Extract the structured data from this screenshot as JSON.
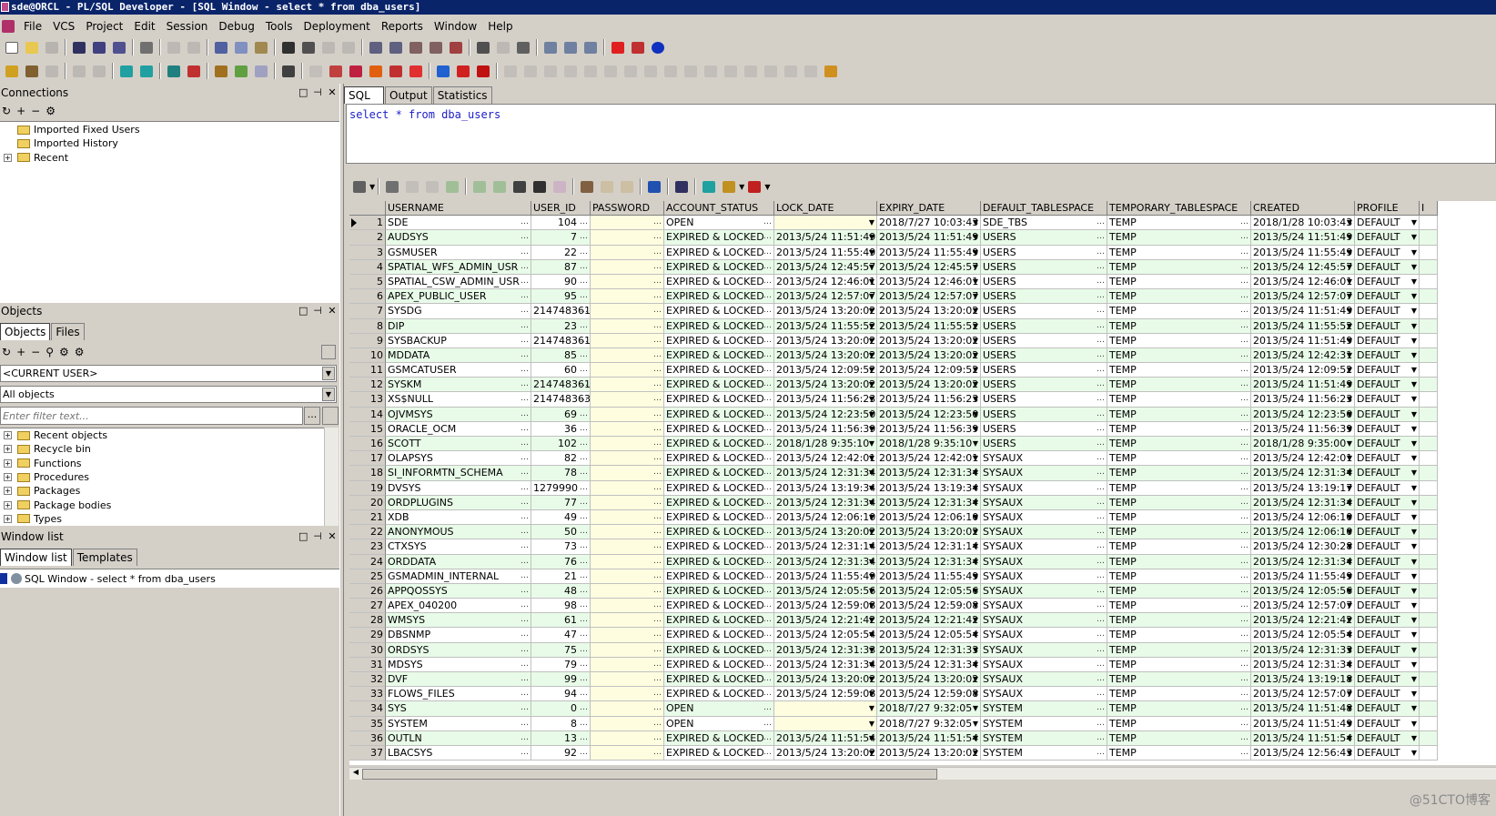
{
  "window_title": "sde@ORCL - PL/SQL Developer - [SQL Window - select * from dba_users]",
  "menu": [
    "File",
    "VCS",
    "Project",
    "Edit",
    "Session",
    "Debug",
    "Tools",
    "Deployment",
    "Reports",
    "Window",
    "Help"
  ],
  "connections": {
    "title": "Connections",
    "items": [
      {
        "label": "Imported Fixed Users",
        "expandable": false
      },
      {
        "label": "Imported History",
        "expandable": false
      },
      {
        "label": "Recent",
        "expandable": true
      }
    ]
  },
  "objects": {
    "title": "Objects",
    "tabs": [
      "Objects",
      "Files"
    ],
    "user_combo": "<CURRENT USER>",
    "filter_combo": "All objects",
    "filter_placeholder": "Enter filter text...",
    "filter_button": "...",
    "items": [
      "Recent objects",
      "Recycle bin",
      "Functions",
      "Procedures",
      "Packages",
      "Package bodies",
      "Types"
    ]
  },
  "window_list": {
    "title": "Window list",
    "tabs": [
      "Window list",
      "Templates"
    ],
    "items": [
      "SQL Window - select * from dba_users"
    ]
  },
  "sql_tabs": [
    "SQL",
    "Output",
    "Statistics"
  ],
  "sql_text": "select * from dba_users",
  "grid": {
    "columns": [
      "USERNAME",
      "USER_ID",
      "PASSWORD",
      "ACCOUNT_STATUS",
      "LOCK_DATE",
      "EXPIRY_DATE",
      "DEFAULT_TABLESPACE",
      "TEMPORARY_TABLESPACE",
      "CREATED",
      "PROFILE",
      "I"
    ],
    "rows": [
      [
        "1",
        "SDE",
        "104",
        "",
        "OPEN",
        "",
        "2018/7/27 10:03:43",
        "SDE_TBS",
        "TEMP",
        "2018/1/28 10:03:43",
        "DEFAULT"
      ],
      [
        "2",
        "AUDSYS",
        "7",
        "",
        "EXPIRED & LOCKED",
        "2013/5/24 11:51:49",
        "2013/5/24 11:51:49",
        "USERS",
        "TEMP",
        "2013/5/24 11:51:49",
        "DEFAULT"
      ],
      [
        "3",
        "GSMUSER",
        "22",
        "",
        "EXPIRED & LOCKED",
        "2013/5/24 11:55:49",
        "2013/5/24 11:55:49",
        "USERS",
        "TEMP",
        "2013/5/24 11:55:49",
        "DEFAULT"
      ],
      [
        "4",
        "SPATIAL_WFS_ADMIN_USR",
        "87",
        "",
        "EXPIRED & LOCKED",
        "2013/5/24 12:45:57",
        "2013/5/24 12:45:57",
        "USERS",
        "TEMP",
        "2013/5/24 12:45:57",
        "DEFAULT"
      ],
      [
        "5",
        "SPATIAL_CSW_ADMIN_USR",
        "90",
        "",
        "EXPIRED & LOCKED",
        "2013/5/24 12:46:01",
        "2013/5/24 12:46:01",
        "USERS",
        "TEMP",
        "2013/5/24 12:46:01",
        "DEFAULT"
      ],
      [
        "6",
        "APEX_PUBLIC_USER",
        "95",
        "",
        "EXPIRED & LOCKED",
        "2013/5/24 12:57:07",
        "2013/5/24 12:57:07",
        "USERS",
        "TEMP",
        "2013/5/24 12:57:07",
        "DEFAULT"
      ],
      [
        "7",
        "SYSDG",
        "2147483618",
        "",
        "EXPIRED & LOCKED",
        "2013/5/24 13:20:02",
        "2013/5/24 13:20:02",
        "USERS",
        "TEMP",
        "2013/5/24 11:51:49",
        "DEFAULT"
      ],
      [
        "8",
        "DIP",
        "23",
        "",
        "EXPIRED & LOCKED",
        "2013/5/24 11:55:52",
        "2013/5/24 11:55:52",
        "USERS",
        "TEMP",
        "2013/5/24 11:55:52",
        "DEFAULT"
      ],
      [
        "9",
        "SYSBACKUP",
        "2147483617",
        "",
        "EXPIRED & LOCKED",
        "2013/5/24 13:20:02",
        "2013/5/24 13:20:02",
        "USERS",
        "TEMP",
        "2013/5/24 11:51:49",
        "DEFAULT"
      ],
      [
        "10",
        "MDDATA",
        "85",
        "",
        "EXPIRED & LOCKED",
        "2013/5/24 13:20:02",
        "2013/5/24 13:20:02",
        "USERS",
        "TEMP",
        "2013/5/24 12:42:31",
        "DEFAULT"
      ],
      [
        "11",
        "GSMCATUSER",
        "60",
        "",
        "EXPIRED & LOCKED",
        "2013/5/24 12:09:52",
        "2013/5/24 12:09:52",
        "USERS",
        "TEMP",
        "2013/5/24 12:09:52",
        "DEFAULT"
      ],
      [
        "12",
        "SYSKM",
        "2147483619",
        "",
        "EXPIRED & LOCKED",
        "2013/5/24 13:20:02",
        "2013/5/24 13:20:02",
        "USERS",
        "TEMP",
        "2013/5/24 11:51:49",
        "DEFAULT"
      ],
      [
        "13",
        "XS$NULL",
        "2147483638",
        "",
        "EXPIRED & LOCKED",
        "2013/5/24 11:56:23",
        "2013/5/24 11:56:23",
        "USERS",
        "TEMP",
        "2013/5/24 11:56:23",
        "DEFAULT"
      ],
      [
        "14",
        "OJVMSYS",
        "69",
        "",
        "EXPIRED & LOCKED",
        "2013/5/24 12:23:50",
        "2013/5/24 12:23:50",
        "USERS",
        "TEMP",
        "2013/5/24 12:23:50",
        "DEFAULT"
      ],
      [
        "15",
        "ORACLE_OCM",
        "36",
        "",
        "EXPIRED & LOCKED",
        "2013/5/24 11:56:39",
        "2013/5/24 11:56:39",
        "USERS",
        "TEMP",
        "2013/5/24 11:56:39",
        "DEFAULT"
      ],
      [
        "16",
        "SCOTT",
        "102",
        "",
        "EXPIRED & LOCKED",
        "2018/1/28 9:35:10",
        "2018/1/28 9:35:10",
        "USERS",
        "TEMP",
        "2018/1/28 9:35:00",
        "DEFAULT"
      ],
      [
        "17",
        "OLAPSYS",
        "82",
        "",
        "EXPIRED & LOCKED",
        "2013/5/24 12:42:01",
        "2013/5/24 12:42:01",
        "SYSAUX",
        "TEMP",
        "2013/5/24 12:42:01",
        "DEFAULT"
      ],
      [
        "18",
        "SI_INFORMTN_SCHEMA",
        "78",
        "",
        "EXPIRED & LOCKED",
        "2013/5/24 12:31:34",
        "2013/5/24 12:31:34",
        "SYSAUX",
        "TEMP",
        "2013/5/24 12:31:34",
        "DEFAULT"
      ],
      [
        "19",
        "DVSYS",
        "1279990",
        "",
        "EXPIRED & LOCKED",
        "2013/5/24 13:19:34",
        "2013/5/24 13:19:34",
        "SYSAUX",
        "TEMP",
        "2013/5/24 13:19:17",
        "DEFAULT"
      ],
      [
        "20",
        "ORDPLUGINS",
        "77",
        "",
        "EXPIRED & LOCKED",
        "2013/5/24 12:31:34",
        "2013/5/24 12:31:34",
        "SYSAUX",
        "TEMP",
        "2013/5/24 12:31:34",
        "DEFAULT"
      ],
      [
        "21",
        "XDB",
        "49",
        "",
        "EXPIRED & LOCKED",
        "2013/5/24 12:06:10",
        "2013/5/24 12:06:10",
        "SYSAUX",
        "TEMP",
        "2013/5/24 12:06:10",
        "DEFAULT"
      ],
      [
        "22",
        "ANONYMOUS",
        "50",
        "",
        "EXPIRED & LOCKED",
        "2013/5/24 13:20:02",
        "2013/5/24 13:20:02",
        "SYSAUX",
        "TEMP",
        "2013/5/24 12:06:10",
        "DEFAULT"
      ],
      [
        "23",
        "CTXSYS",
        "73",
        "",
        "EXPIRED & LOCKED",
        "2013/5/24 12:31:14",
        "2013/5/24 12:31:14",
        "SYSAUX",
        "TEMP",
        "2013/5/24 12:30:28",
        "DEFAULT"
      ],
      [
        "24",
        "ORDDATA",
        "76",
        "",
        "EXPIRED & LOCKED",
        "2013/5/24 12:31:34",
        "2013/5/24 12:31:34",
        "SYSAUX",
        "TEMP",
        "2013/5/24 12:31:34",
        "DEFAULT"
      ],
      [
        "25",
        "GSMADMIN_INTERNAL",
        "21",
        "",
        "EXPIRED & LOCKED",
        "2013/5/24 11:55:49",
        "2013/5/24 11:55:49",
        "SYSAUX",
        "TEMP",
        "2013/5/24 11:55:49",
        "DEFAULT"
      ],
      [
        "26",
        "APPQOSSYS",
        "48",
        "",
        "EXPIRED & LOCKED",
        "2013/5/24 12:05:56",
        "2013/5/24 12:05:56",
        "SYSAUX",
        "TEMP",
        "2013/5/24 12:05:56",
        "DEFAULT"
      ],
      [
        "27",
        "APEX_040200",
        "98",
        "",
        "EXPIRED & LOCKED",
        "2013/5/24 12:59:08",
        "2013/5/24 12:59:08",
        "SYSAUX",
        "TEMP",
        "2013/5/24 12:57:07",
        "DEFAULT"
      ],
      [
        "28",
        "WMSYS",
        "61",
        "",
        "EXPIRED & LOCKED",
        "2013/5/24 12:21:42",
        "2013/5/24 12:21:42",
        "SYSAUX",
        "TEMP",
        "2013/5/24 12:21:42",
        "DEFAULT"
      ],
      [
        "29",
        "DBSNMP",
        "47",
        "",
        "EXPIRED & LOCKED",
        "2013/5/24 12:05:54",
        "2013/5/24 12:05:54",
        "SYSAUX",
        "TEMP",
        "2013/5/24 12:05:54",
        "DEFAULT"
      ],
      [
        "30",
        "ORDSYS",
        "75",
        "",
        "EXPIRED & LOCKED",
        "2013/5/24 12:31:33",
        "2013/5/24 12:31:33",
        "SYSAUX",
        "TEMP",
        "2013/5/24 12:31:33",
        "DEFAULT"
      ],
      [
        "31",
        "MDSYS",
        "79",
        "",
        "EXPIRED & LOCKED",
        "2013/5/24 12:31:34",
        "2013/5/24 12:31:34",
        "SYSAUX",
        "TEMP",
        "2013/5/24 12:31:34",
        "DEFAULT"
      ],
      [
        "32",
        "DVF",
        "99",
        "",
        "EXPIRED & LOCKED",
        "2013/5/24 13:20:02",
        "2013/5/24 13:20:02",
        "SYSAUX",
        "TEMP",
        "2013/5/24 13:19:18",
        "DEFAULT"
      ],
      [
        "33",
        "FLOWS_FILES",
        "94",
        "",
        "EXPIRED & LOCKED",
        "2013/5/24 12:59:08",
        "2013/5/24 12:59:08",
        "SYSAUX",
        "TEMP",
        "2013/5/24 12:57:07",
        "DEFAULT"
      ],
      [
        "34",
        "SYS",
        "0",
        "",
        "OPEN",
        "",
        "2018/7/27 9:32:05",
        "SYSTEM",
        "TEMP",
        "2013/5/24 11:51:48",
        "DEFAULT"
      ],
      [
        "35",
        "SYSTEM",
        "8",
        "",
        "OPEN",
        "",
        "2018/7/27 9:32:05",
        "SYSTEM",
        "TEMP",
        "2013/5/24 11:51:49",
        "DEFAULT"
      ],
      [
        "36",
        "OUTLN",
        "13",
        "",
        "EXPIRED & LOCKED",
        "2013/5/24 11:51:54",
        "2013/5/24 11:51:54",
        "SYSTEM",
        "TEMP",
        "2013/5/24 11:51:54",
        "DEFAULT"
      ],
      [
        "37",
        "LBACSYS",
        "92",
        "",
        "EXPIRED & LOCKED",
        "2013/5/24 13:20:02",
        "2013/5/24 13:20:02",
        "SYSTEM",
        "TEMP",
        "2013/5/24 12:56:43",
        "DEFAULT"
      ]
    ]
  },
  "watermark": "@51CTO博客",
  "colors": {
    "title_bar": "#0a246a",
    "odd_row": "#e8fbe8",
    "sql_keyword": "#1c1cc8",
    "chrome": "#d4d0c8"
  }
}
